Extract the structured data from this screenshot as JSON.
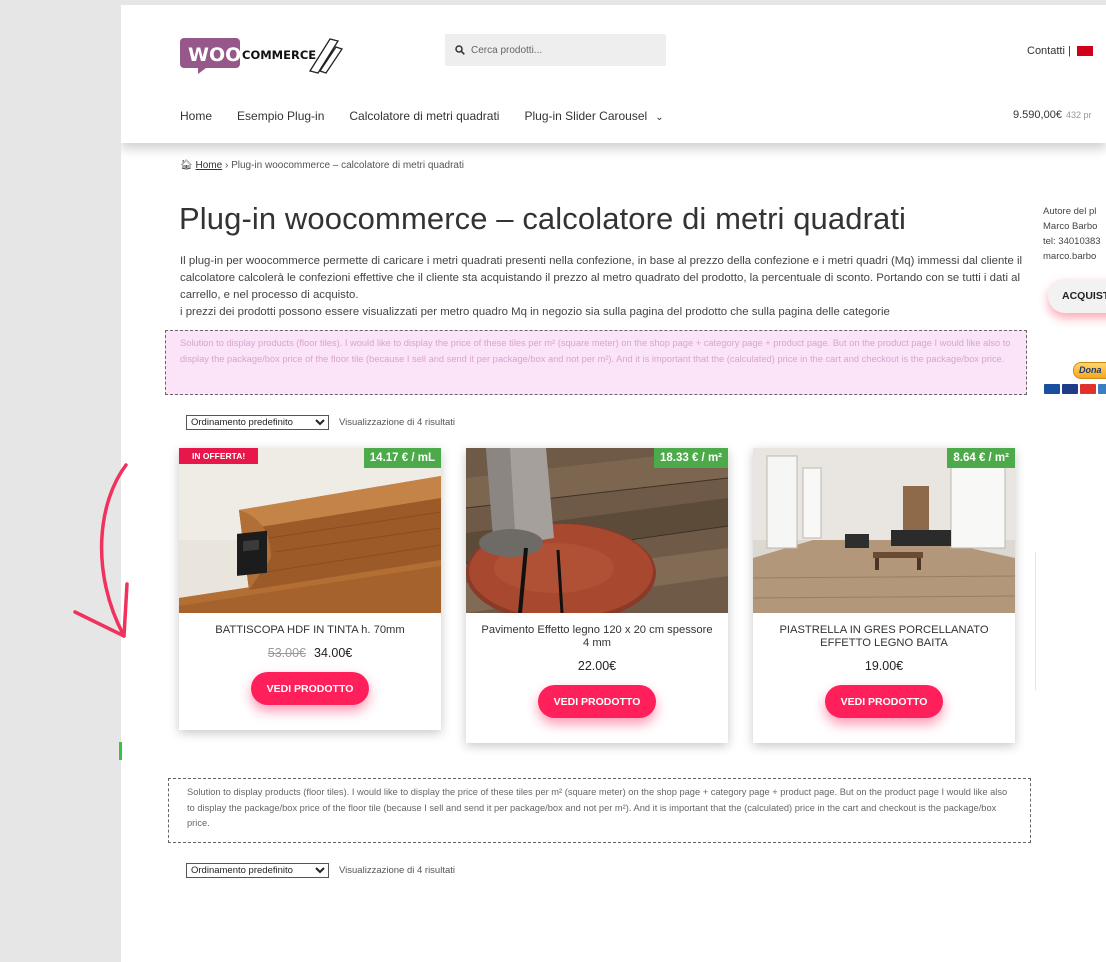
{
  "header": {
    "logo_woo": "WOO",
    "logo_commerce": "COMMERCE",
    "search_placeholder": "Cerca prodotti...",
    "contacts": "Contatti |",
    "nav": [
      "Home",
      "Esempio Plug-in",
      "Calcolatore di metri quadrati",
      "Plug-in Slider Carousel"
    ],
    "cart_total": "9.590,00€",
    "cart_count": "432 pr"
  },
  "breadcrumb": {
    "home": "Home",
    "separator": "›",
    "current": "Plug-in woocommerce – calcolatore di metri quadrati"
  },
  "page_title": "Plug-in woocommerce – calcolatore di metri quadrati",
  "intro": {
    "line1": "Il plug-in per woocommerce permette di caricare i metri quadrati presenti nella confezione, in base al prezzo della confezione e i metri quadri (Mq) immessi dal cliente il calcolatore calcolerà le confezioni effettive che il cliente sta acquistando il prezzo al metro quadrato del prodotto, la percentuale di sconto. Portando con se tutti i dati al carrello, e nel processo di acquisto.",
    "line2": "i prezzi dei prodotti possono essere visualizzati per metro quadro Mq in negozio sia sulla pagina del prodotto che sulla pagina delle categorie"
  },
  "notice_text": "Solution to display products (floor tiles). I would like to display the price of these tiles per m² (square meter) on the shop page + category page + product page. But on the product page I would like also to display the package/box price of the floor tile (because I sell and send it per package/box and not per m²). And it is important that the (calculated) price in the cart and checkout is the package/box price.",
  "sorting": {
    "selected": "Ordinamento predefinito",
    "result_count": "Visualizzazione di 4 risultati"
  },
  "products": [
    {
      "name": "BATTISCOPA HDF IN TINTA h. 70mm",
      "badge": "IN OFFERTA!",
      "unit_price": "14.17 € / mL",
      "old_price": "53.00€",
      "price": "34.00€",
      "button": "VEDI PRODOTTO"
    },
    {
      "name": "Pavimento Effetto legno 120 x 20 cm spessore 4 mm",
      "unit_price": "18.33 € / m²",
      "price": "22.00€",
      "button": "VEDI PRODOTTO"
    },
    {
      "name": "PIASTRELLA IN GRES PORCELLANATO EFFETTO LEGNO BAITA",
      "unit_price": "8.64 € / m²",
      "price": "19.00€",
      "button": "VEDI PRODOTTO"
    }
  ],
  "sidebar": {
    "lines": [
      "Autore del pl",
      "Marco Barbo",
      "tel: 34010383",
      "marco.barbo"
    ],
    "buy_button": "ACQUIST",
    "donate": "Dona"
  },
  "colors": {
    "accent": "#ff1f5a",
    "price_tag": "#4caa4a",
    "notice_bg": "#fbe3f8"
  }
}
